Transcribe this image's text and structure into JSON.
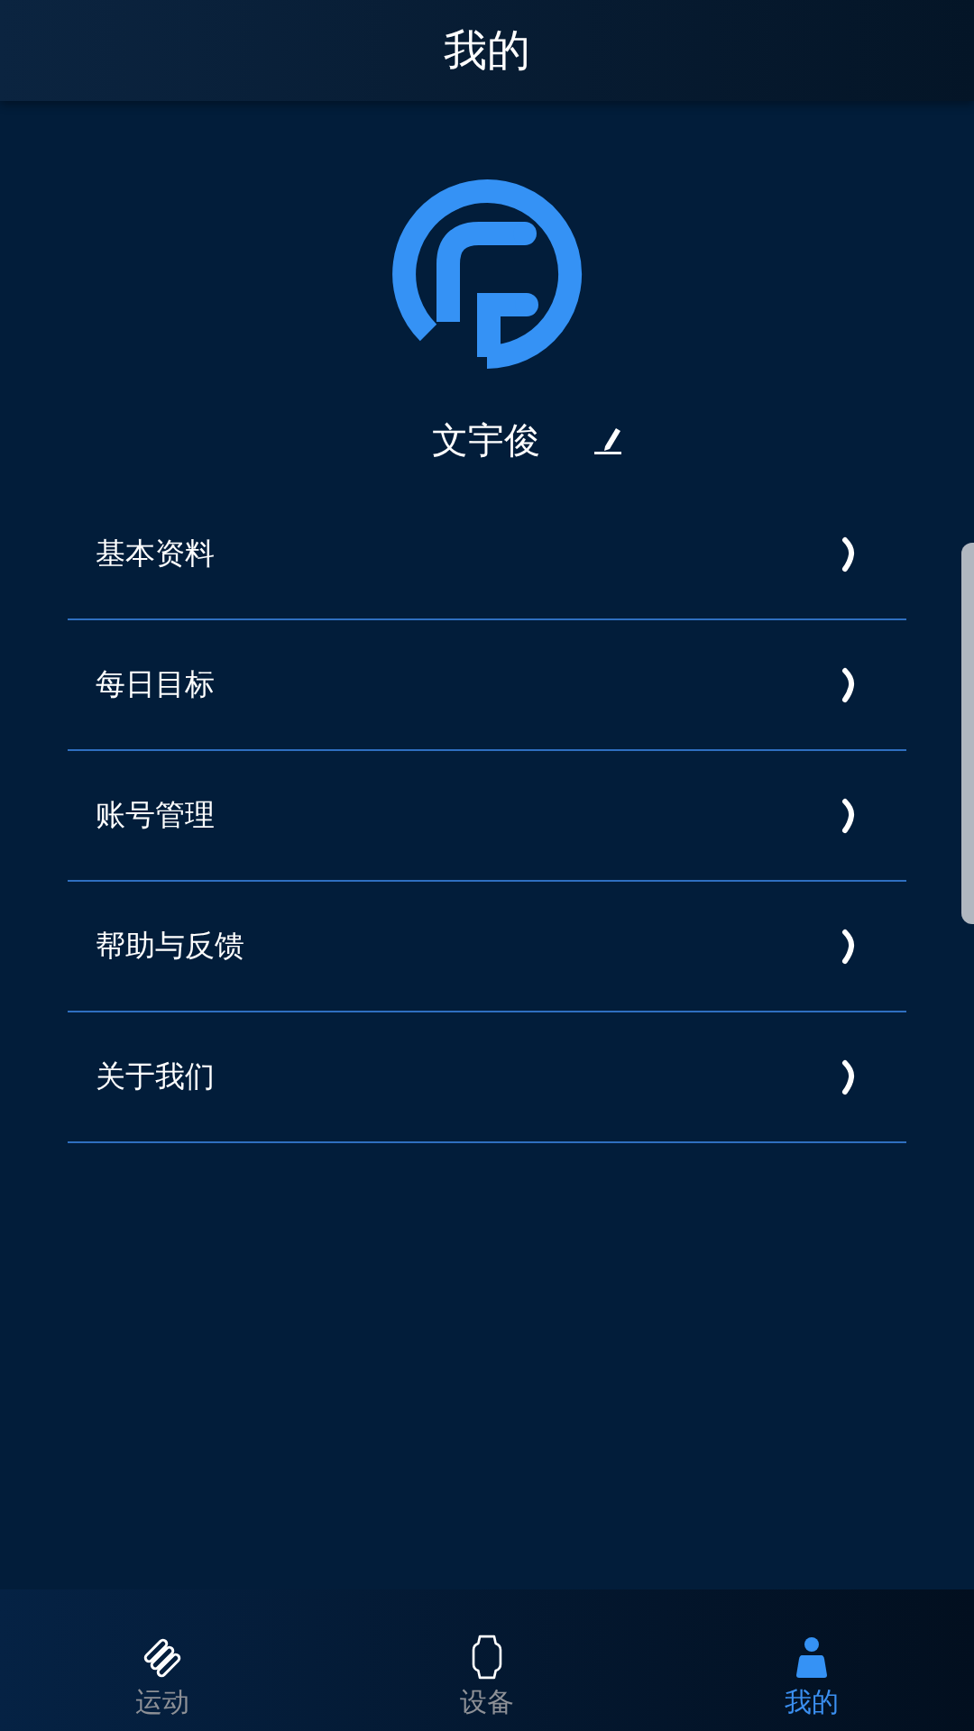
{
  "header": {
    "title": "我的"
  },
  "profile": {
    "name": "文宇俊"
  },
  "menu": [
    {
      "label": "基本资料"
    },
    {
      "label": "每日目标"
    },
    {
      "label": "账号管理"
    },
    {
      "label": "帮助与反馈"
    },
    {
      "label": "关于我们"
    }
  ],
  "tabs": [
    {
      "label": "运动",
      "kind": "exercise",
      "selected": false
    },
    {
      "label": "设备",
      "kind": "device",
      "selected": false
    },
    {
      "label": "我的",
      "kind": "profile",
      "selected": true
    }
  ]
}
